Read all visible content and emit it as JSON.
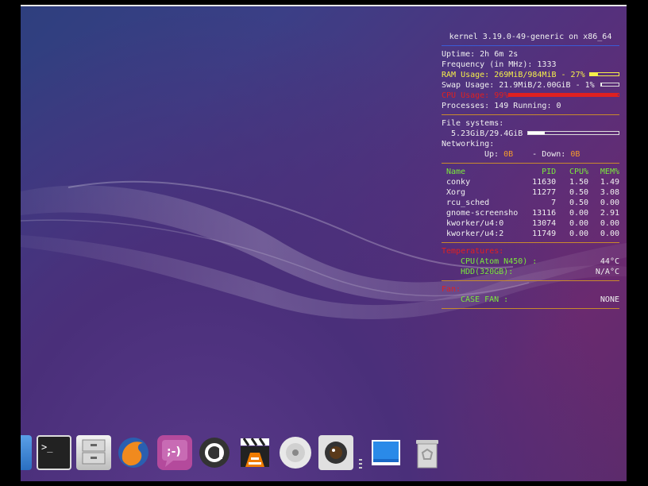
{
  "conky": {
    "kernel": "kernel 3.19.0-49-generic on x86_64",
    "uptime": "Uptime: 2h 6m 2s",
    "frequency": "Frequency (in MHz): 1333",
    "ram": "RAM Usage: 269MiB/984MiB - 27%",
    "ram_pct": 27,
    "swap": "Swap Usage: 21.9MiB/2.00GiB - 1%",
    "swap_pct": 1,
    "cpu": "CPU Usage: 99%",
    "cpu_pct": 99,
    "processes": "Processes: 149  Running: 0",
    "fs_label": "File systems:",
    "fs_value": "5.23GiB/29.4GiB",
    "fs_pct": 18,
    "net_label": "Networking:",
    "net_up_label": "Up:",
    "net_up": "0B",
    "net_down_label": "- Down:",
    "net_down": "0B",
    "table_headers": {
      "name": "Name",
      "pid": "PID",
      "cpu": "CPU%",
      "mem": "MEM%"
    },
    "processes_list": [
      {
        "name": "conky",
        "pid": "11630",
        "cpu": "1.50",
        "mem": "1.49"
      },
      {
        "name": "Xorg",
        "pid": "11277",
        "cpu": "0.50",
        "mem": "3.08"
      },
      {
        "name": "rcu_sched",
        "pid": "7",
        "cpu": "0.50",
        "mem": "0.00"
      },
      {
        "name": "gnome-screensho",
        "pid": "13116",
        "cpu": "0.00",
        "mem": "2.91"
      },
      {
        "name": "kworker/u4:0",
        "pid": "13074",
        "cpu": "0.00",
        "mem": "0.00"
      },
      {
        "name": "kworker/u4:2",
        "pid": "11749",
        "cpu": "0.00",
        "mem": "0.00"
      }
    ],
    "temp_title": "Temperatures:",
    "temp_cpu_label": "CPU(Atom N450)   :",
    "temp_cpu_value": "44°C",
    "temp_hdd_label": "HDD(320GB):",
    "temp_hdd_value": "N/A°C",
    "fan_title": "Fan:",
    "fan_label": "CASE FAN   :",
    "fan_value": "NONE"
  },
  "dock": {
    "items": [
      "terminal",
      "file-cabinet",
      "firefox",
      "pidgin",
      "amarok",
      "clapperboard",
      "vlc",
      "disc",
      "camera",
      "desktop",
      "trash"
    ]
  },
  "colors": {
    "accent_divider": "#c98a2c",
    "title_line": "#3b5bd6",
    "green": "#7bea3c",
    "red": "#e02020",
    "yellow": "#f5ef4a",
    "orange": "#f59a2c"
  }
}
